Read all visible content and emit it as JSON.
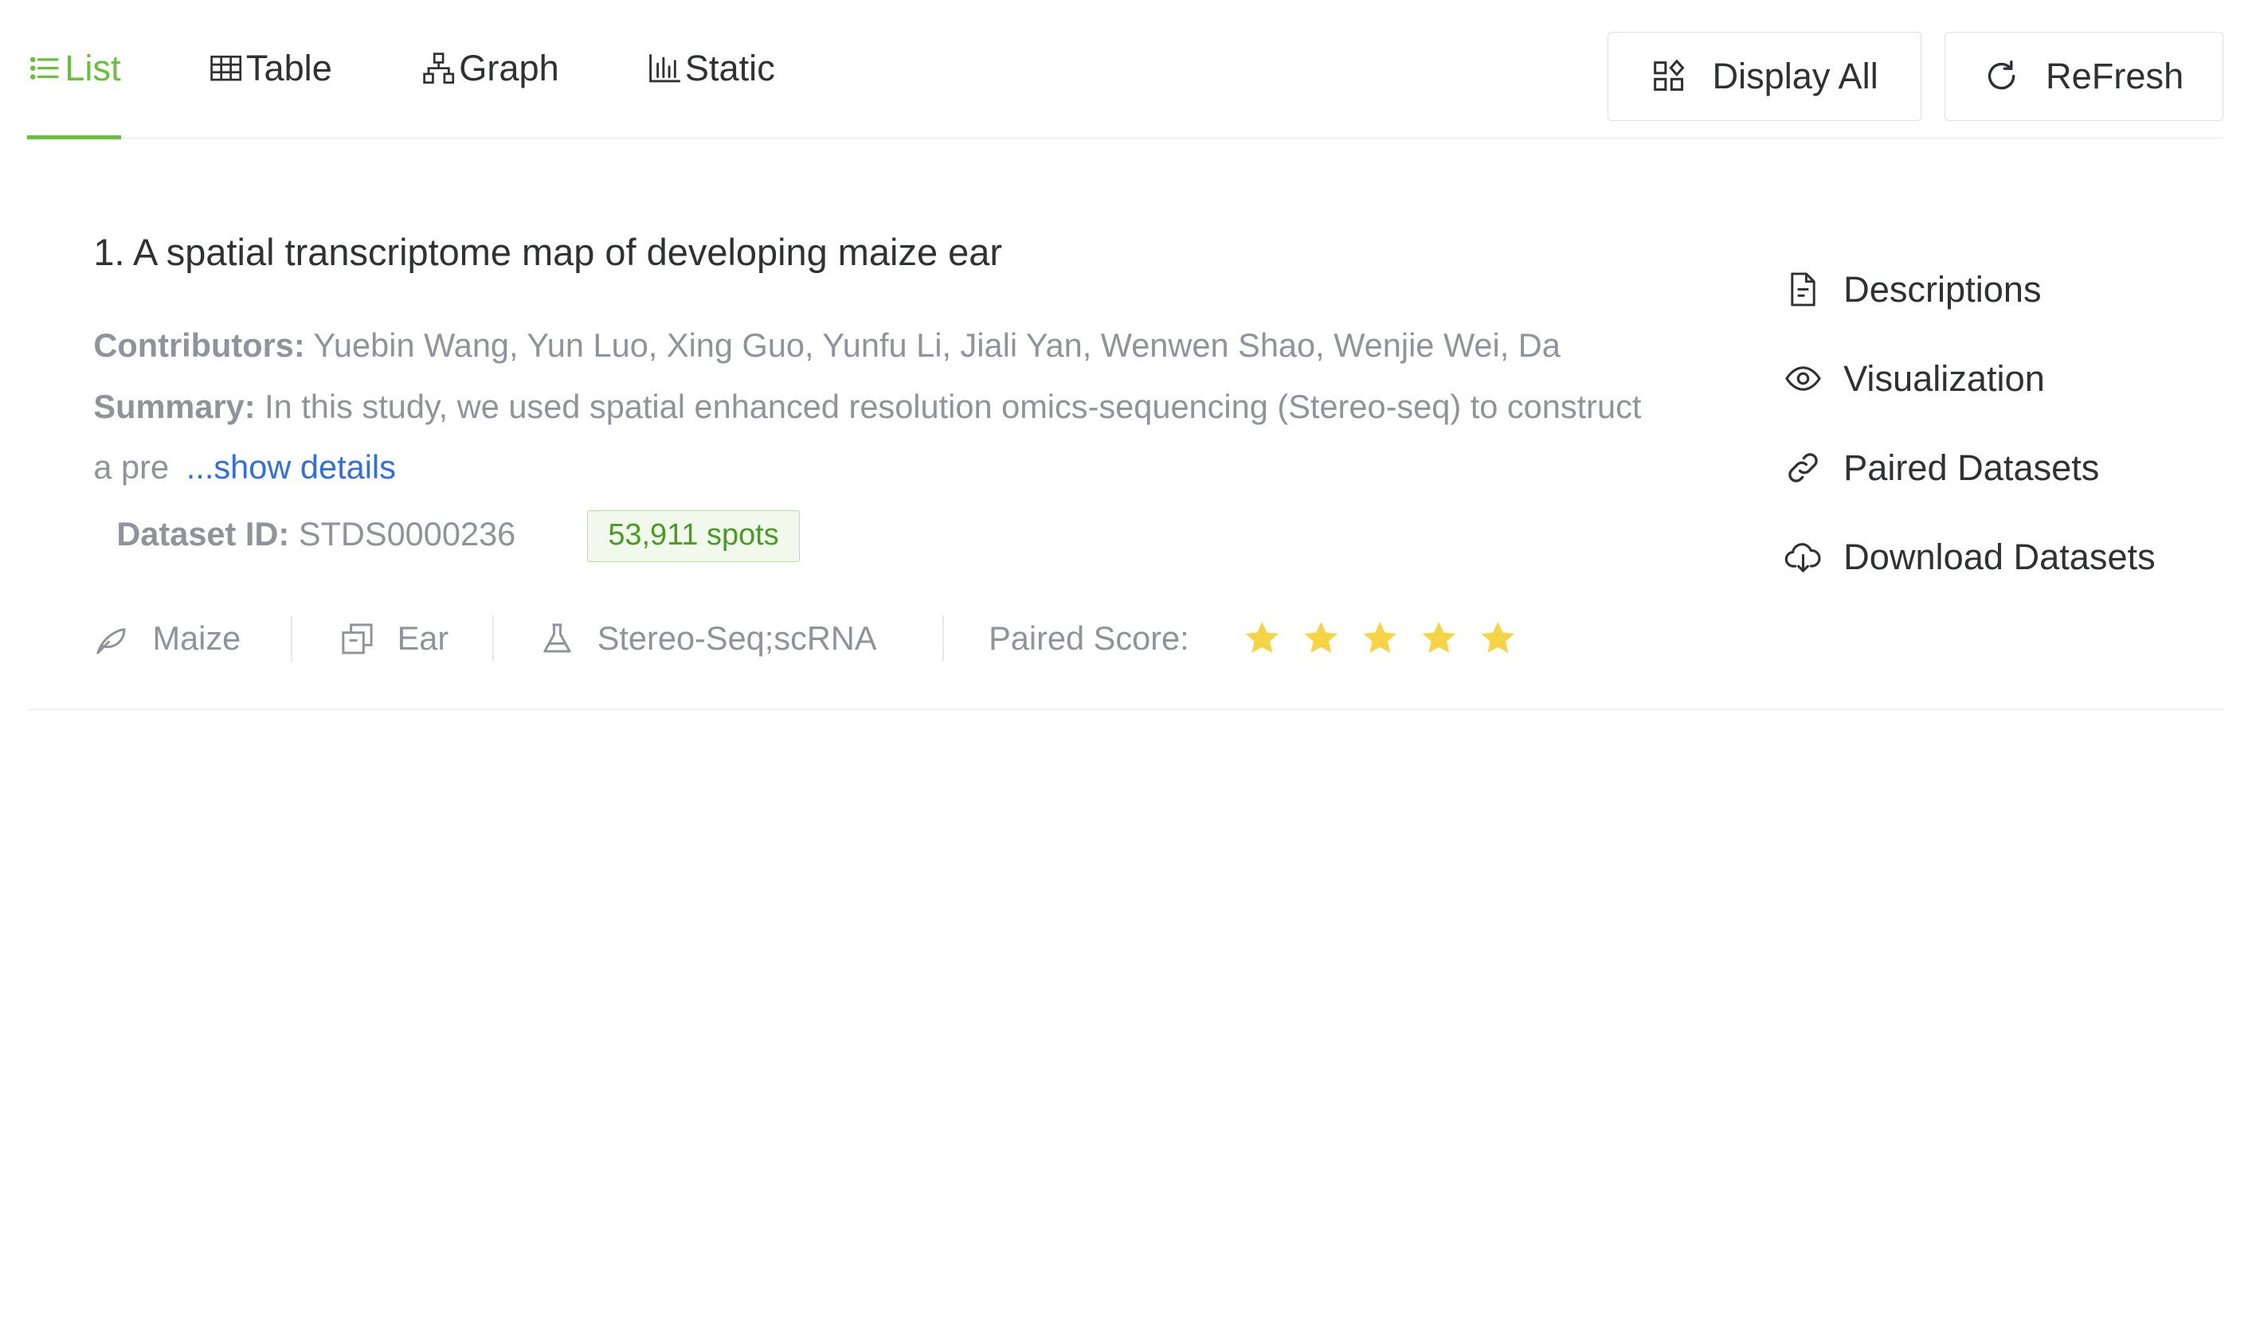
{
  "tabs": [
    {
      "label": "List",
      "icon": "list-icon",
      "active": true
    },
    {
      "label": "Table",
      "icon": "table-icon",
      "active": false
    },
    {
      "label": "Graph",
      "icon": "graph-icon",
      "active": false
    },
    {
      "label": "Static",
      "icon": "bar-chart-icon",
      "active": false
    }
  ],
  "toolbar": {
    "display_all_label": "Display All",
    "refresh_label": "ReFresh"
  },
  "dataset": {
    "title": "1. A spatial transcriptome map of developing maize ear",
    "contributors_label": "Contributors:",
    "contributors": "Yuebin Wang, Yun Luo, Xing Guo, Yunfu Li, Jiali Yan, Wenwen Shao, Wenjie Wei, Da",
    "summary_label": "Summary:",
    "summary": "In this study, we used spatial enhanced resolution omics-sequencing (Stereo-seq) to construct a pre",
    "show_details": "...show details",
    "id_label": "Dataset ID:",
    "id": "STDS0000236",
    "spots": "53,911 spots",
    "species": "Maize",
    "tissue": "Ear",
    "technology": "Stereo-Seq;scRNA",
    "paired_score_label": "Paired Score:",
    "paired_score": 5,
    "paired_score_max": 5
  },
  "actions": [
    {
      "label": "Descriptions",
      "icon": "document-icon"
    },
    {
      "label": "Visualization",
      "icon": "eye-icon"
    },
    {
      "label": "Paired Datasets",
      "icon": "link-icon"
    },
    {
      "label": "Download Datasets",
      "icon": "cloud-download-icon"
    }
  ],
  "colors": {
    "accent": "#67c23a",
    "link": "#2f6fde",
    "star": "#f7d443",
    "muted_text": "#909399"
  }
}
